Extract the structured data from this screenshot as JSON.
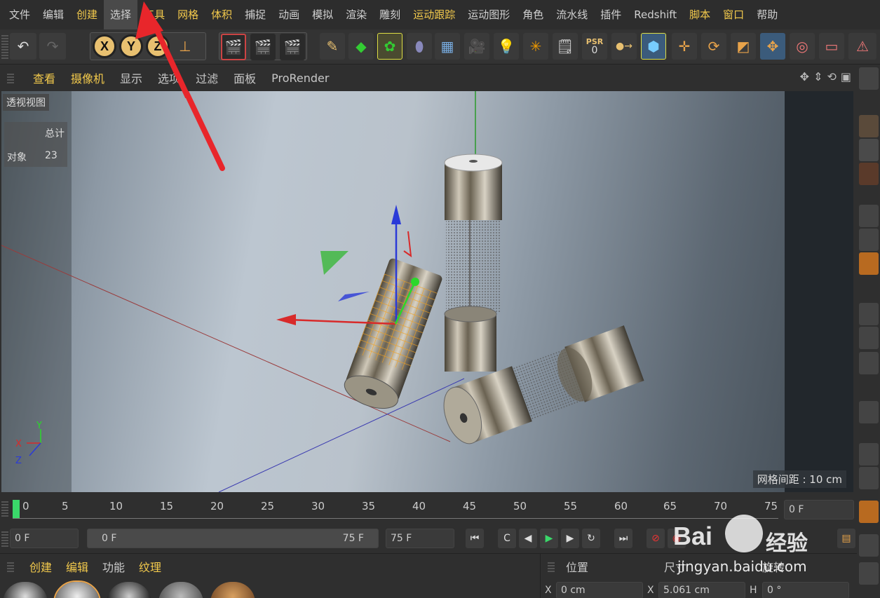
{
  "menubar": {
    "items": [
      {
        "label": "文件",
        "hl": false
      },
      {
        "label": "编辑",
        "hl": false
      },
      {
        "label": "创建",
        "hl": true
      },
      {
        "label": "选择",
        "hl": false,
        "active": true
      },
      {
        "label": "工具",
        "hl": true
      },
      {
        "label": "网格",
        "hl": true
      },
      {
        "label": "体积",
        "hl": true
      },
      {
        "label": "捕捉",
        "hl": false
      },
      {
        "label": "动画",
        "hl": false
      },
      {
        "label": "模拟",
        "hl": false
      },
      {
        "label": "渲染",
        "hl": false
      },
      {
        "label": "雕刻",
        "hl": false
      },
      {
        "label": "运动跟踪",
        "hl": true
      },
      {
        "label": "运动图形",
        "hl": false
      },
      {
        "label": "角色",
        "hl": false
      },
      {
        "label": "流水线",
        "hl": false
      },
      {
        "label": "插件",
        "hl": false
      },
      {
        "label": "Redshift",
        "hl": false
      },
      {
        "label": "脚本",
        "hl": true
      },
      {
        "label": "窗口",
        "hl": true
      },
      {
        "label": "帮助",
        "hl": false
      }
    ]
  },
  "toolbar": {
    "axis_x": "X",
    "axis_y": "Y",
    "axis_z": "Z",
    "psr_label": "PSR",
    "psr_value": "0"
  },
  "viewbar": {
    "items": [
      {
        "label": "查看",
        "hl": true
      },
      {
        "label": "摄像机",
        "hl": true
      },
      {
        "label": "显示",
        "hl": false
      },
      {
        "label": "选项",
        "hl": false
      },
      {
        "label": "过滤",
        "hl": false
      },
      {
        "label": "面板",
        "hl": false
      },
      {
        "label": "ProRender",
        "hl": false
      }
    ]
  },
  "viewport": {
    "view_name": "透视视图",
    "stats_header": "总计",
    "stats_label": "对象",
    "stats_value": "23",
    "grid_spacing": "网格间距 : 10 cm",
    "axis_y": "Y",
    "axis_x": "X",
    "axis_z": "Z"
  },
  "timeline": {
    "ticks": [
      "0",
      "5",
      "10",
      "15",
      "20",
      "25",
      "30",
      "35",
      "40",
      "45",
      "50",
      "55",
      "60",
      "65",
      "70",
      "75"
    ],
    "end_frame": "0 F"
  },
  "transport": {
    "current_frame": "0 F",
    "range_start": "0 F",
    "range_end": "75 F",
    "max_frame": "75 F"
  },
  "bottom": {
    "materials_tabs": [
      {
        "label": "创建",
        "hl": true
      },
      {
        "label": "编辑",
        "hl": true
      },
      {
        "label": "功能",
        "hl": false
      },
      {
        "label": "纹理",
        "hl": true
      }
    ],
    "coords_tabs": [
      "位置",
      "尺寸",
      "旋转"
    ],
    "pos_x_label": "X",
    "pos_x": "0 cm",
    "size_x_label": "X",
    "size_x": "5.061 cm",
    "rot_h_label": "H",
    "rot_h": "0 °"
  },
  "watermark": {
    "brand": "Bai",
    "suffix": "经验",
    "url": "jingyan.baidu.com"
  },
  "colors": {
    "accent": "#f2c94c",
    "arrow": "#e8262b"
  }
}
